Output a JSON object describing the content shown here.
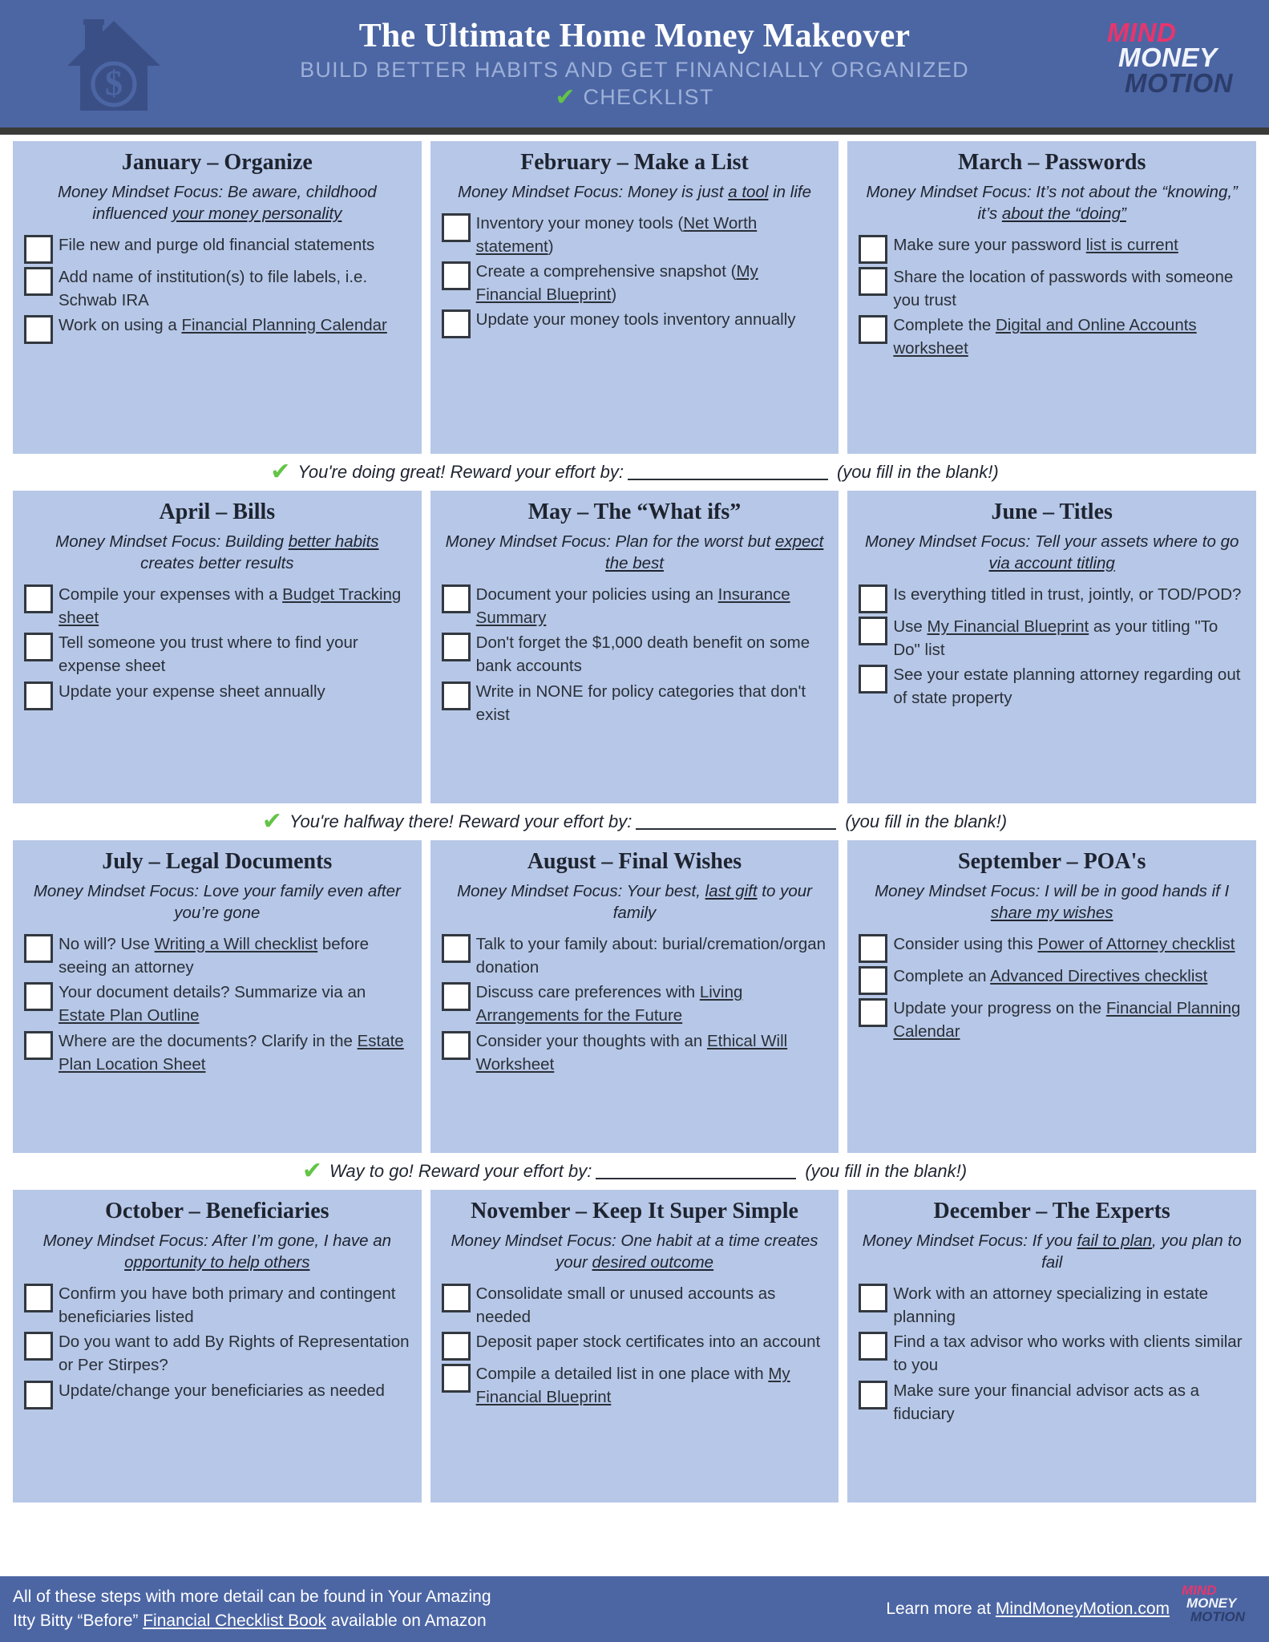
{
  "header": {
    "title": "The Ultimate Home Money Makeover",
    "subtitle": "BUILD BETTER HABITS AND GET FINANCIALLY ORGANIZED",
    "checklist_label": "CHECKLIST",
    "check_icon": "green-check",
    "house_icon": "house-dollar-icon",
    "logo": {
      "line1": "MIND",
      "line2": "MONEY",
      "line3": "MOTION"
    },
    "colors": {
      "header_bg": "#4c66a4",
      "card_bg": "#b7c7e7",
      "check_green": "#63c446",
      "logo_pink": "#e8356d",
      "logo_navy": "#2c3d6b",
      "rule_dark": "#3a3a38"
    }
  },
  "months": [
    {
      "title": "January – Organize",
      "focus_prefix": "Money Mindset Focus:  Be aware, childhood influenced ",
      "focus_underline": "your money personality",
      "focus_suffix": "",
      "items": [
        {
          "pre": "File new and purge old financial statements",
          "link": "",
          "post": ""
        },
        {
          "pre": "Add name of institution(s) to file labels, i.e. Schwab IRA",
          "link": "",
          "post": ""
        },
        {
          "pre": "Work on using a ",
          "link": "Financial Planning Calendar",
          "post": ""
        }
      ]
    },
    {
      "title": "February – Make a List",
      "focus_prefix": "Money Mindset Focus: Money is just ",
      "focus_underline": "a tool",
      "focus_suffix": " in life",
      "items": [
        {
          "pre": "Inventory your money tools (",
          "link": "Net Worth statement",
          "post": ")"
        },
        {
          "pre": "Create a comprehensive snapshot (",
          "link": "My Financial Blueprint",
          "post": ")"
        },
        {
          "pre": "Update your money tools inventory annually",
          "link": "",
          "post": ""
        }
      ]
    },
    {
      "title": "March – Passwords",
      "focus_prefix": "Money Mindset Focus: It’s not about the “knowing,” it’s ",
      "focus_underline": "about the “doing”",
      "focus_suffix": "",
      "items": [
        {
          "pre": "Make sure your password ",
          "link": "list is current",
          "post": ""
        },
        {
          "pre": "Share the location of passwords with someone you trust",
          "link": "",
          "post": ""
        },
        {
          "pre": "Complete the ",
          "link": "Digital and Online Accounts worksheet",
          "post": ""
        }
      ]
    },
    {
      "title": "April – Bills",
      "focus_prefix": "Money Mindset Focus: Building ",
      "focus_underline": "better habits",
      "focus_suffix": " creates better results",
      "items": [
        {
          "pre": "Compile your expenses with a ",
          "link": "Budget Tracking sheet",
          "post": ""
        },
        {
          "pre": "Tell someone you trust where to find your expense sheet",
          "link": "",
          "post": ""
        },
        {
          "pre": "Update your expense sheet annually",
          "link": "",
          "post": ""
        }
      ]
    },
    {
      "title": "May – The “What ifs”",
      "focus_prefix": "Money Mindset Focus: Plan for the worst but ",
      "focus_underline": "expect the best",
      "focus_suffix": "",
      "items": [
        {
          "pre": "Document your policies using an ",
          "link": "Insurance Summary",
          "post": ""
        },
        {
          "pre": "Don't forget the $1,000 death benefit on some bank accounts",
          "link": "",
          "post": ""
        },
        {
          "pre": "Write in NONE for policy categories that don't exist",
          "link": "",
          "post": ""
        }
      ]
    },
    {
      "title": "June – Titles",
      "focus_prefix": "Money Mindset Focus: Tell your assets where to go ",
      "focus_underline": "via account titling",
      "focus_suffix": "",
      "items": [
        {
          "pre": "Is everything titled in trust, jointly, or TOD/POD?",
          "link": "",
          "post": ""
        },
        {
          "pre": "Use ",
          "link": "My Financial Blueprint",
          "post": " as your titling \"To Do\" list"
        },
        {
          "pre": "See your estate planning attorney regarding out of state property",
          "link": "",
          "post": ""
        }
      ]
    },
    {
      "title": "July – Legal Documents",
      "focus_prefix": "Money Mindset Focus: Love your family even after you’re gone",
      "focus_underline": "",
      "focus_suffix": "",
      "items": [
        {
          "pre": "No will? Use ",
          "link": "Writing a Will checklist",
          "post": " before seeing an attorney"
        },
        {
          "pre": "Your document details? Summarize via an ",
          "link": "Estate Plan Outline",
          "post": ""
        },
        {
          "pre": "Where are the documents? Clarify in the ",
          "link": "Estate Plan Location Sheet",
          "post": ""
        }
      ]
    },
    {
      "title": "August – Final Wishes",
      "focus_prefix": "Money Mindset Focus: Your best, ",
      "focus_underline": "last gift",
      "focus_suffix": " to your family",
      "items": [
        {
          "pre": "Talk to your family about: burial/cremation/organ donation",
          "link": "",
          "post": ""
        },
        {
          "pre": "Discuss care preferences with ",
          "link": "Living Arrangements for the Future",
          "post": ""
        },
        {
          "pre": "Consider your thoughts with an ",
          "link": "Ethical Will Worksheet",
          "post": ""
        }
      ]
    },
    {
      "title": "September – POA's",
      "focus_prefix": "Money Mindset Focus: I will be in good hands if I ",
      "focus_underline": "share my wishes",
      "focus_suffix": "",
      "items": [
        {
          "pre": "Consider using this ",
          "link": "Power of Attorney checklist",
          "post": ""
        },
        {
          "pre": "Complete an ",
          "link": "Advanced Directives checklist",
          "post": ""
        },
        {
          "pre": "Update your progress on  the ",
          "link": "Financial Planning Calendar",
          "post": ""
        }
      ]
    },
    {
      "title": "October – Beneficiaries",
      "focus_prefix": "Money Mindset Focus: After I’m gone, I have an ",
      "focus_underline": "opportunity to help others",
      "focus_suffix": "",
      "items": [
        {
          "pre": "Confirm you have both primary and contingent beneficiaries listed",
          "link": "",
          "post": ""
        },
        {
          "pre": "Do you want to add By Rights of Representation or Per Stirpes?",
          "link": "",
          "post": ""
        },
        {
          "pre": "Update/change your beneficiaries as needed",
          "link": "",
          "post": ""
        }
      ]
    },
    {
      "title": "November – Keep It Super Simple",
      "focus_prefix": "Money Mindset Focus: One habit at a time creates your ",
      "focus_underline": "desired outcome",
      "focus_suffix": "",
      "items": [
        {
          "pre": "Consolidate small or unused accounts as needed",
          "link": "",
          "post": ""
        },
        {
          "pre": "Deposit paper stock certificates into an account",
          "link": "",
          "post": ""
        },
        {
          "pre": "Compile a detailed list in one place with ",
          "link": "My Financial Blueprint",
          "post": ""
        }
      ]
    },
    {
      "title": "December – The Experts",
      "focus_prefix": "Money Mindset Focus: If you ",
      "focus_underline": "fail to plan",
      "focus_suffix": ", you plan to fail",
      "items": [
        {
          "pre": "Work with an attorney specializing in estate planning",
          "link": "",
          "post": ""
        },
        {
          "pre": "Find a tax advisor who works with clients similar to you",
          "link": "",
          "post": ""
        },
        {
          "pre": "Make sure your financial advisor acts as a fiduciary",
          "link": "",
          "post": ""
        }
      ]
    }
  ],
  "dividers": [
    {
      "text": "You're doing great! Reward your effort by:",
      "hint": "(you fill in the blank!)",
      "icon": "green-check"
    },
    {
      "text": "You're halfway there! Reward your effort by:",
      "hint": "(you fill in the blank!)",
      "icon": "green-check"
    },
    {
      "text": "Way to go! Reward your effort by:",
      "hint": "(you fill in the blank!)",
      "icon": "green-check"
    }
  ],
  "footer": {
    "left_line1": "All of these steps with more detail can be found in Your Amazing",
    "left_line2_pre": "Itty Bitty “Before” ",
    "left_line2_link": "Financial Checklist Book",
    "left_line2_post": " available on Amazon",
    "learn_pre": "Learn more at ",
    "learn_link": "MindMoneyMotion.com",
    "logo": {
      "line1": "MIND",
      "line2": "MONEY",
      "line3": "MOTION"
    }
  }
}
